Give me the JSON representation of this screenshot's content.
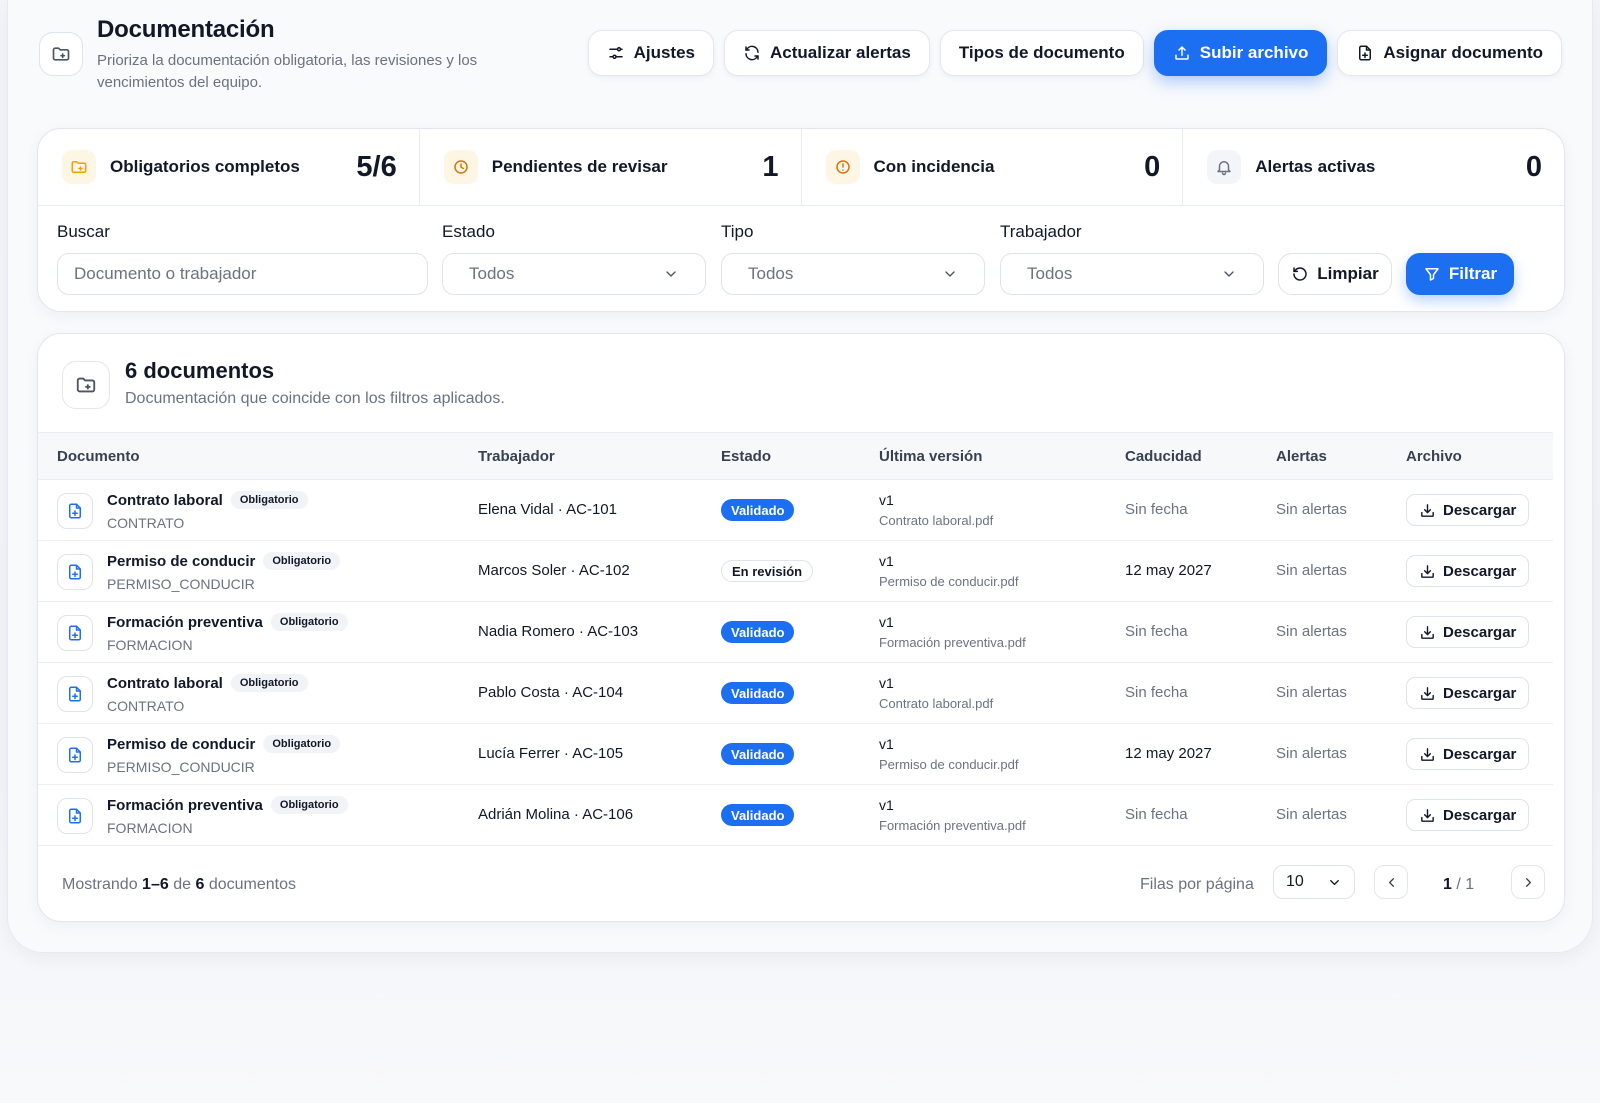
{
  "header": {
    "title": "Documentación",
    "subtitle": "Prioriza la documentación obligatoria, las revisiones y los vencimientos del equipo."
  },
  "toolbar": {
    "settings_label": "Ajustes",
    "refresh_alerts_label": "Actualizar alertas",
    "doc_types_label": "Tipos de documento",
    "upload_label": "Subir archivo",
    "assign_label": "Asignar documento"
  },
  "stats": [
    {
      "label": "Obligatorios completos",
      "value": "5/6",
      "icon": "folder-icon",
      "color": "#f59e0b"
    },
    {
      "label": "Pendientes de revisar",
      "value": "1",
      "icon": "clock-icon",
      "color": "#d97706"
    },
    {
      "label": "Con incidencia",
      "value": "0",
      "icon": "alert-circle-icon",
      "color": "#d97706"
    },
    {
      "label": "Alertas activas",
      "value": "0",
      "icon": "bell-icon",
      "color": "#6b7280"
    }
  ],
  "filters": {
    "search_label": "Buscar",
    "search_placeholder": "Documento o trabajador",
    "status_label": "Estado",
    "status_value": "Todos",
    "type_label": "Tipo",
    "type_value": "Todos",
    "worker_label": "Trabajador",
    "worker_value": "Todos",
    "clear_label": "Limpiar",
    "filter_label": "Filtrar"
  },
  "documents": {
    "title": "6 documentos",
    "subtitle": "Documentación que coincide con los filtros aplicados.",
    "columns": [
      "Documento",
      "Trabajador",
      "Estado",
      "Última versión",
      "Caducidad",
      "Alertas",
      "Archivo"
    ],
    "rows": [
      {
        "name": "Contrato laboral",
        "tag": "Obligatorio",
        "code": "CONTRATO",
        "worker": "Elena Vidal · AC-101",
        "status": "Validado",
        "status_type": "ok",
        "version": "v1",
        "file": "Contrato laboral.pdf",
        "expiry": "Sin fecha",
        "alerts": "Sin alertas",
        "action": "Descargar"
      },
      {
        "name": "Permiso de conducir",
        "tag": "Obligatorio",
        "code": "PERMISO_CONDUCIR",
        "worker": "Marcos Soler · AC-102",
        "status": "En revisión",
        "status_type": "rev",
        "version": "v1",
        "file": "Permiso de conducir.pdf",
        "expiry": "12 may 2027",
        "alerts": "Sin alertas",
        "action": "Descargar"
      },
      {
        "name": "Formación preventiva",
        "tag": "Obligatorio",
        "code": "FORMACION",
        "worker": "Nadia Romero · AC-103",
        "status": "Validado",
        "status_type": "ok",
        "version": "v1",
        "file": "Formación preventiva.pdf",
        "expiry": "Sin fecha",
        "alerts": "Sin alertas",
        "action": "Descargar"
      },
      {
        "name": "Contrato laboral",
        "tag": "Obligatorio",
        "code": "CONTRATO",
        "worker": "Pablo Costa · AC-104",
        "status": "Validado",
        "status_type": "ok",
        "version": "v1",
        "file": "Contrato laboral.pdf",
        "expiry": "Sin fecha",
        "alerts": "Sin alertas",
        "action": "Descargar"
      },
      {
        "name": "Permiso de conducir",
        "tag": "Obligatorio",
        "code": "PERMISO_CONDUCIR",
        "worker": "Lucía Ferrer · AC-105",
        "status": "Validado",
        "status_type": "ok",
        "version": "v1",
        "file": "Permiso de conducir.pdf",
        "expiry": "12 may 2027",
        "alerts": "Sin alertas",
        "action": "Descargar"
      },
      {
        "name": "Formación preventiva",
        "tag": "Obligatorio",
        "code": "FORMACION",
        "worker": "Adrián Molina · AC-106",
        "status": "Validado",
        "status_type": "ok",
        "version": "v1",
        "file": "Formación preventiva.pdf",
        "expiry": "Sin fecha",
        "alerts": "Sin alertas",
        "action": "Descargar"
      }
    ]
  },
  "footer": {
    "showing_prefix": "Mostrando",
    "showing_range": "1–6",
    "showing_of": "de",
    "showing_total": "6",
    "showing_suffix": "documentos",
    "rows_per_page_label": "Filas por página",
    "rows_per_page_value": "10",
    "page_current": "1",
    "page_total": "/ 1"
  },
  "colors": {
    "accent": "#1d6ff2",
    "text": "#111827",
    "muted": "#6b7280",
    "border": "#e3e6ec"
  }
}
